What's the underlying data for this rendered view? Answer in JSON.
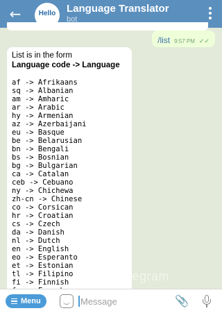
{
  "header": {
    "title": "Language Translator",
    "subtitle": "bot",
    "avatar_text": "Hello"
  },
  "messages": {
    "outgoing": {
      "text": "/list",
      "time": "9:57 PM"
    },
    "incoming": {
      "intro_line1": "List is in the form",
      "intro_line2": "Language code -> Language",
      "languages": [
        "af -> Afrikaans",
        "sq -> Albanian",
        "am -> Amharic",
        "ar -> Arabic",
        "hy -> Armenian",
        "az -> Azerbaijani",
        "eu -> Basque",
        "be -> Belarusian",
        "bn -> Bengali",
        "bs -> Bosnian",
        "bg -> Bulgarian",
        "ca -> Catalan",
        "ceb -> Cebuano",
        "ny -> Chichewa",
        "zh-cn -> Chinese",
        "co -> Corsican",
        "hr -> Croatian",
        "cs -> Czech",
        "da -> Danish",
        "nl -> Dutch",
        "en -> English",
        "eo -> Esperanto",
        "et -> Estonian",
        "tl -> Filipino",
        "fi -> Finnish",
        "fr -> French"
      ]
    }
  },
  "watermark": "ofTelegram",
  "input_bar": {
    "menu_label": "Menu",
    "placeholder": "Message"
  },
  "colors": {
    "header": "#5b8fbd",
    "menu_button": "#4b9bd8",
    "outgoing_bubble": "#eefed9"
  }
}
